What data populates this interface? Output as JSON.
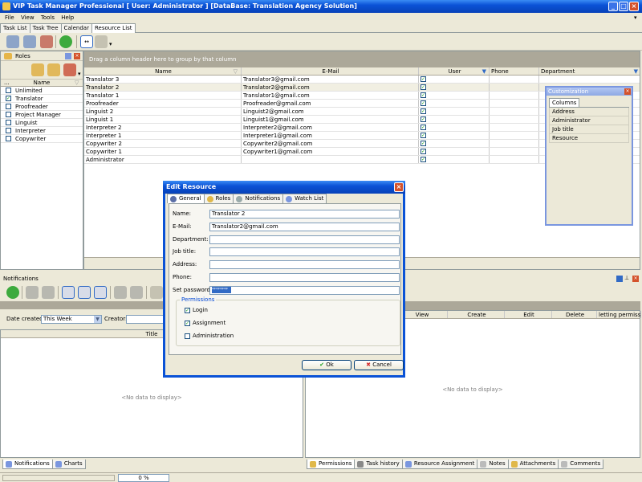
{
  "window": {
    "title": "VIP Task Manager Professional [ User: Administrator ] [DataBase: Translation Agency Solution]"
  },
  "menu": [
    "File",
    "View",
    "Tools",
    "Help"
  ],
  "tabs": [
    "Task List",
    "Task Tree",
    "Calendar",
    "Resource List"
  ],
  "roles": {
    "title": "Roles",
    "column": "Name",
    "items": [
      {
        "label": "Unlimited",
        "checked": false
      },
      {
        "label": "Translator",
        "checked": true
      },
      {
        "label": "Proofreader",
        "checked": false
      },
      {
        "label": "Project Manager",
        "checked": false
      },
      {
        "label": "Linguist",
        "checked": false
      },
      {
        "label": "Interpreter",
        "checked": false
      },
      {
        "label": "Copywriter",
        "checked": false
      }
    ]
  },
  "grid": {
    "groupby_hint": "Drag a column header here to group by that column",
    "columns": [
      "Name",
      "E-Mail",
      "User",
      "Phone",
      "Department"
    ],
    "rows": [
      {
        "name": "Translator 3",
        "email": "Translator3@gmail.com"
      },
      {
        "name": "Translator 2",
        "email": "Translator2@gmail.com"
      },
      {
        "name": "Translator 1",
        "email": "Translator1@gmail.com"
      },
      {
        "name": "Proofreader",
        "email": "Proofreader@gmail.com"
      },
      {
        "name": "Linguist 2",
        "email": "Linguist2@gmail.com"
      },
      {
        "name": "Linguist 1",
        "email": "Linguist1@gmail.com"
      },
      {
        "name": "Interpreter 2",
        "email": "Interpreter2@gmail.com"
      },
      {
        "name": "Interpreter 1",
        "email": "Interpreter1@gmail.com"
      },
      {
        "name": "Copywriter 2",
        "email": "Copywriter2@gmail.com"
      },
      {
        "name": "Copywriter 1",
        "email": "Copywriter1@gmail.com"
      },
      {
        "name": "Administrator",
        "email": ""
      }
    ]
  },
  "customization": {
    "title": "Customization",
    "tab": "Columns",
    "items": [
      "Address",
      "Administrator",
      "Job title",
      "Resource"
    ]
  },
  "notifications": {
    "title": "Notifications",
    "date_label": "Date created:",
    "date_value": "This Week",
    "creator_label": "Creator:",
    "column": "Title",
    "no_data": "<No data to display>"
  },
  "permissions": {
    "columns": [
      "View",
      "Create",
      "Edit",
      "Delete",
      "letting permission"
    ],
    "no_data": "<No data to display>"
  },
  "bottom_tabs_left": [
    "Notifications",
    "Charts"
  ],
  "bottom_tabs_right": [
    "Permissions",
    "Task history",
    "Resource Assignment",
    "Notes",
    "Attachments",
    "Comments"
  ],
  "status": {
    "progress": "0 %"
  },
  "dialog": {
    "title": "Edit Resource",
    "tabs": [
      "General",
      "Roles",
      "Notifications",
      "Watch List"
    ],
    "fields": [
      {
        "label": "Name:",
        "value": "Translator 2"
      },
      {
        "label": "E-Mail:",
        "value": "Translator2@gmail.com"
      },
      {
        "label": "Department:",
        "value": ""
      },
      {
        "label": "Job title:",
        "value": ""
      },
      {
        "label": "Address:",
        "value": ""
      },
      {
        "label": "Phone:",
        "value": ""
      },
      {
        "label": "Set password:",
        "value": "********"
      }
    ],
    "permissions_legend": "Permissions",
    "permissions": [
      {
        "label": "Login",
        "checked": true
      },
      {
        "label": "Assignment",
        "checked": true
      },
      {
        "label": "Administration",
        "checked": false
      }
    ],
    "ok": "Ok",
    "cancel": "Cancel"
  }
}
